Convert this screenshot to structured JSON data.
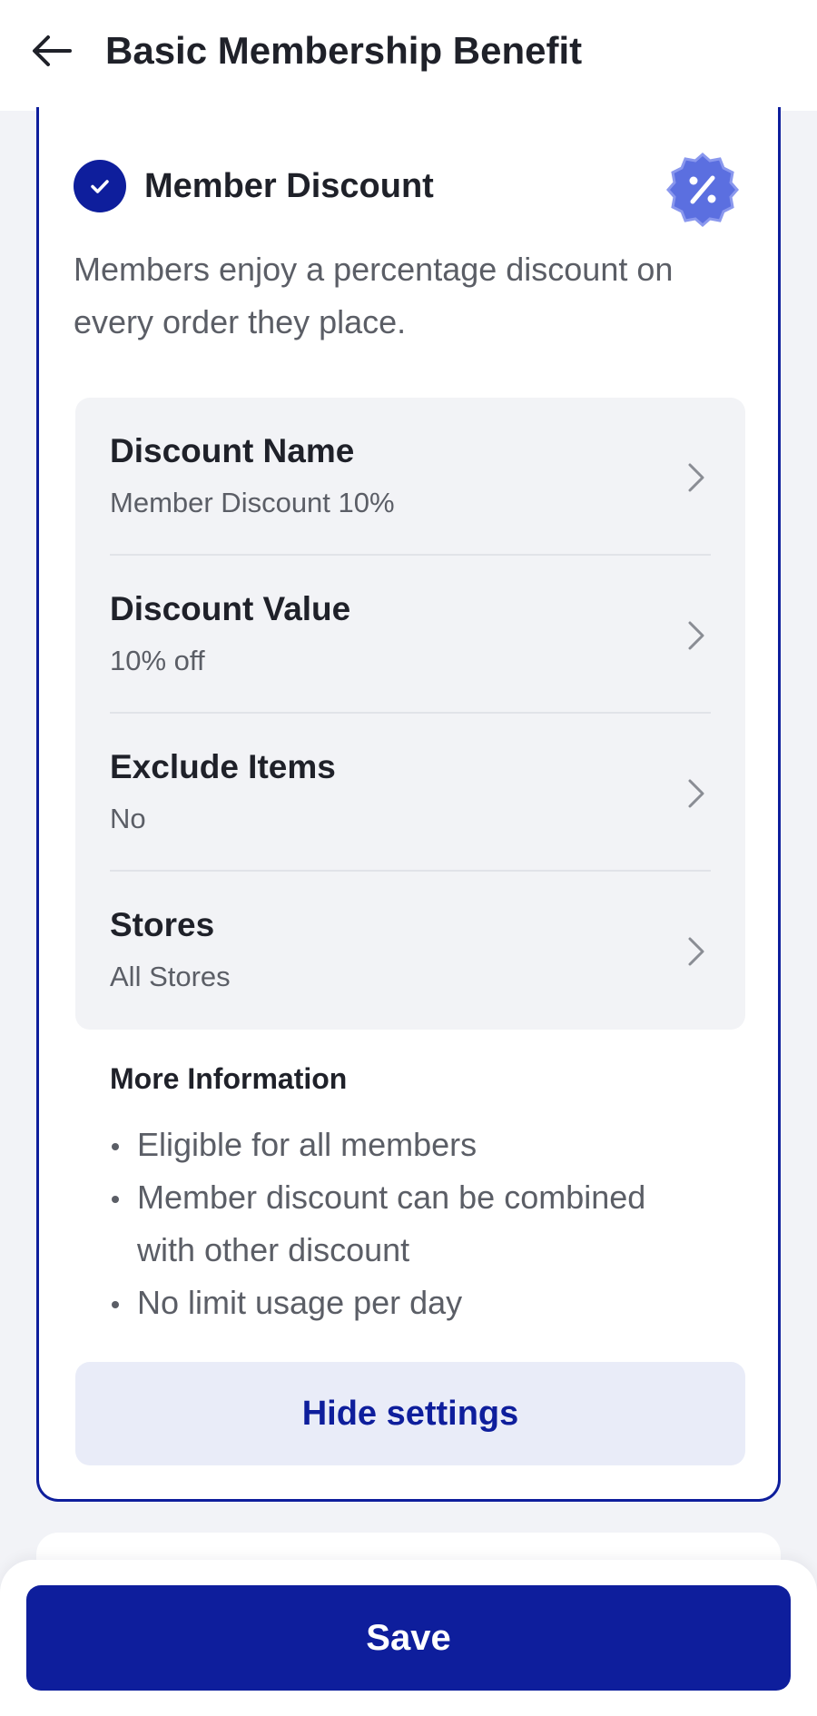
{
  "header": {
    "title": "Basic Membership Benefit",
    "back_icon": "arrow-left-icon"
  },
  "benefit": {
    "title": "Member Discount",
    "checked": true,
    "check_icon": "check-icon",
    "badge_icon": "discount-badge-icon",
    "description": "Members enjoy a percentage discount on every order they place.",
    "settings": [
      {
        "label": "Discount Name",
        "value": "Member Discount 10%"
      },
      {
        "label": "Discount Value",
        "value": "10% off"
      },
      {
        "label": "Exclude Items",
        "value": "No"
      },
      {
        "label": "Stores",
        "value": "All Stores"
      }
    ],
    "chevron_icon": "chevron-right-icon",
    "more_info": {
      "title": "More Information",
      "items": [
        "Eligible for all members",
        "Member discount can be combined with other discount",
        "No limit usage per day"
      ]
    },
    "hide_settings_label": "Hide settings"
  },
  "footer": {
    "save_label": "Save"
  },
  "colors": {
    "primary": "#0e1e9c",
    "badge": "#5b6fe0",
    "background": "#f2f3f7",
    "settings_bg": "#f2f3f6",
    "secondary_button_bg": "#e9ecf8"
  }
}
